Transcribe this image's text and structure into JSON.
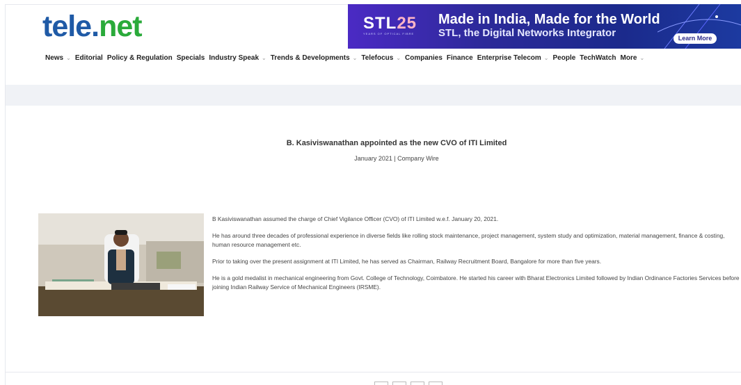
{
  "logo": {
    "tele": "tele",
    "dot": ".",
    "net": "net"
  },
  "banner": {
    "brand": "STL",
    "brand_num": "25",
    "tagline_small": "YEARS OF OPTICAL FIBRE",
    "headline": "Made in India, Made for the World",
    "subline": "STL, the Digital Networks Integrator",
    "cta": "Learn More"
  },
  "nav": {
    "items": [
      {
        "label": "News",
        "dropdown": true
      },
      {
        "label": "Editorial",
        "dropdown": false
      },
      {
        "label": "Policy & Regulation",
        "dropdown": false
      },
      {
        "label": "Specials",
        "dropdown": false
      },
      {
        "label": "Industry Speak",
        "dropdown": true
      },
      {
        "label": "Trends & Developments",
        "dropdown": true
      },
      {
        "label": "Telefocus",
        "dropdown": true
      },
      {
        "label": "Companies",
        "dropdown": false
      },
      {
        "label": "Finance",
        "dropdown": false
      },
      {
        "label": "Enterprise Telecom",
        "dropdown": true
      },
      {
        "label": "People",
        "dropdown": false
      },
      {
        "label": "TechWatch",
        "dropdown": false
      },
      {
        "label": "More",
        "dropdown": true
      }
    ],
    "chevron": "⌄"
  },
  "article": {
    "title": "B. Kasiviswanathan appointed as the new CVO of ITI Limited",
    "meta": "January 2021 | Company Wire",
    "paragraphs": [
      "B Kasiviswanathan assumed the charge of Chief Vigilance Officer (CVO) of ITI Limited w.e.f. January 20, 2021.",
      "He has around three decades of professional experience in diverse fields like rolling stock maintenance, project management, system study and optimization, material management, finance & costing, human resource management etc.",
      "Prior to taking over the present assignment at ITI Limited, he has served as Chairman, Railway Recruitment Board, Bangalore for more than five years.",
      "He is a gold medalist in mechanical engineering from Govt. College of Technology, Coimbatore. He started his career with Bharat Electronics Limited followed by Indian Ordinance Factories Services before joining Indian Railway Service of Mechanical Engineers (IRSME)."
    ]
  },
  "colors": {
    "logo_blue": "#1f5aa6",
    "logo_green": "#2aaa3a",
    "banner": "#2c2a99"
  }
}
